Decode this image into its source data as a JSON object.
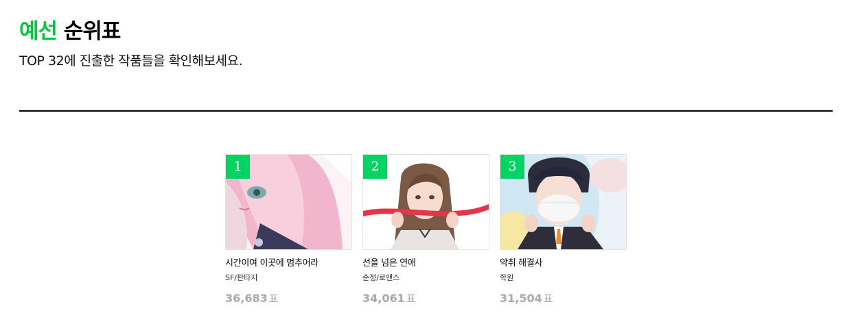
{
  "header": {
    "title_accent": "예선",
    "title_rest": "순위표",
    "subtitle": "TOP 32에 진출한 작품들을 확인해보세요."
  },
  "ranking": [
    {
      "rank": "1",
      "title": "시간이여 이곳에 멈추어라",
      "genre": "SF/판타지",
      "votes": "36,683",
      "unit": "표"
    },
    {
      "rank": "2",
      "title": "선을 넘은 연애",
      "genre": "순정/로맨스",
      "votes": "34,061",
      "unit": "표"
    },
    {
      "rank": "3",
      "title": "악취 해결사",
      "genre": "학원",
      "votes": "31,504",
      "unit": "표"
    }
  ],
  "colors": {
    "accent": "#00c73c",
    "rank_badge": "#00d564",
    "votes": "#a9a9a9"
  }
}
